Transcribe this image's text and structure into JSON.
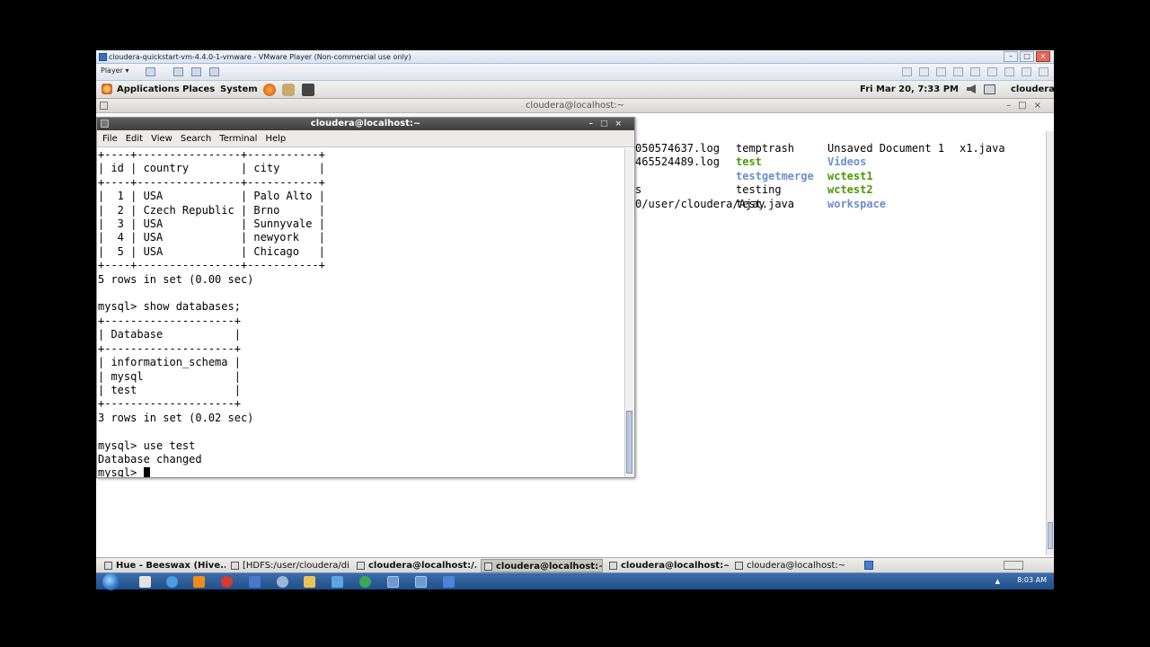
{
  "vm": {
    "title": "cloudera-quickstart-vm-4.4.0-1-vmware - VMware Player (Non-commercial use only)",
    "player_label": "Player ▾"
  },
  "gnome_panel": {
    "applications": "Applications",
    "places": "Places",
    "system": "System",
    "datetime": "Fri Mar 20,  7:33 PM",
    "user": "cloudera"
  },
  "bg_window": {
    "title": "cloudera@localhost:~",
    "ls": {
      "col0": [
        "050574637.log",
        "465524489.log",
        "",
        "s",
        "0/user/cloudera/Ajay"
      ],
      "col1": [
        {
          "text": "temptrash",
          "cls": ""
        },
        {
          "text": "test",
          "cls": "green"
        },
        {
          "text": "testgetmerge",
          "cls": "lightblue"
        },
        {
          "text": "testing",
          "cls": ""
        },
        {
          "text": "test.java",
          "cls": ""
        }
      ],
      "col2": [
        {
          "text": "Unsaved Document 1",
          "cls": ""
        },
        {
          "text": "Videos",
          "cls": "lightblue"
        },
        {
          "text": "wctest1",
          "cls": "green"
        },
        {
          "text": "wctest2",
          "cls": "green"
        },
        {
          "text": "workspace",
          "cls": "lightblue"
        }
      ],
      "col3": [
        "x1.java"
      ]
    }
  },
  "terminal": {
    "title": "cloudera@localhost:~",
    "menu": [
      "File",
      "Edit",
      "View",
      "Search",
      "Terminal",
      "Help"
    ],
    "lines": [
      "+----+----------------+-----------+",
      "| id | country        | city      |",
      "+----+----------------+-----------+",
      "|  1 | USA            | Palo Alto |",
      "|  2 | Czech Republic | Brno      |",
      "|  3 | USA            | Sunnyvale |",
      "|  4 | USA            | newyork   |",
      "|  5 | USA            | Chicago   |",
      "+----+----------------+-----------+",
      "5 rows in set (0.00 sec)",
      "",
      "mysql> show databases;",
      "+--------------------+",
      "| Database           |",
      "+--------------------+",
      "| information_schema |",
      "| mysql              |",
      "| test               |",
      "+--------------------+",
      "3 rows in set (0.02 sec)",
      "",
      "mysql> use test",
      "Database changed"
    ],
    "prompt": "mysql> "
  },
  "taskbar": {
    "tasks": [
      {
        "label": "Hue - Beeswax (Hive...",
        "bold": true,
        "active": false
      },
      {
        "label": "[HDFS:/user/cloudera/di...",
        "bold": false,
        "active": false
      },
      {
        "label": "cloudera@localhost:/...",
        "bold": true,
        "active": false
      },
      {
        "label": "cloudera@localhost:~",
        "bold": true,
        "active": true
      },
      {
        "label": "cloudera@localhost:~",
        "bold": true,
        "active": false
      },
      {
        "label": "cloudera@localhost:~",
        "bold": false,
        "active": false
      }
    ]
  },
  "windows_taskbar": {
    "clock": "8:03 AM",
    "tray_arrow": "▲"
  },
  "colors": {
    "green": "#4a9a06",
    "blue": "#3f6fc4",
    "taskbar": "#1f4f8b"
  }
}
